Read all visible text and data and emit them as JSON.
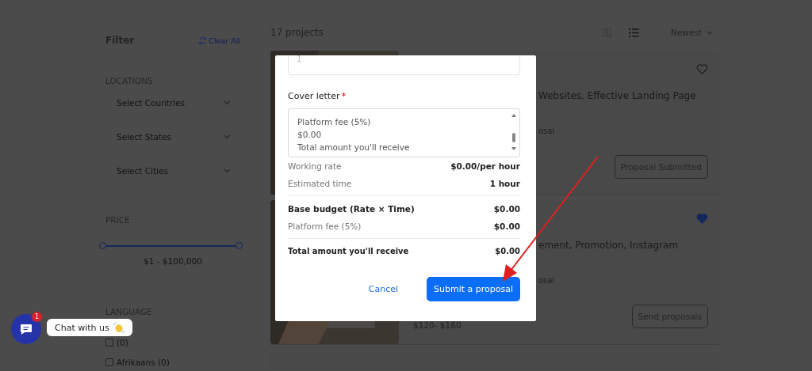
{
  "filter": {
    "title": "Filter",
    "clear_all": "Clear All",
    "locations_heading": "LOCATIONS",
    "selects": [
      "Select Countries",
      "Select States",
      "Select Cities"
    ],
    "price_heading": "PRICE",
    "price_range": {
      "low": {
        "level": 0
      },
      "high": {
        "level": 1
      }
    },
    "price_reading": "$1 - $100,000",
    "language_heading": "LANGUAGE",
    "languages": [
      {
        "label": "(0)",
        "checked": false
      },
      {
        "label": "Afrikaans (0)",
        "checked": false
      }
    ]
  },
  "toolbar": {
    "count": "17 projects",
    "views": [
      {
        "kind": "grid",
        "selected": false
      },
      {
        "kind": "list",
        "selected": true
      }
    ],
    "sort": "Newest"
  },
  "projects": [
    {
      "title": "Websites, Effective Landing Page",
      "meta": "osal",
      "favorite": false,
      "button": "Proposal Submitted"
    },
    {
      "title": "ement, Promotion, Instagram",
      "meta": "osal",
      "price": "$120- $160",
      "favorite": true,
      "button": "Send proposals"
    }
  ],
  "modal": {
    "field_value": "1",
    "cover_letter_label": "Cover letter",
    "required": true,
    "cover_letter_lines": [
      "Platform fee (5%)",
      "$0.00",
      "Total amount you'll receive"
    ],
    "sections": [
      {
        "rows": [
          {
            "label": "Working rate",
            "value": "$0.00/per hour",
            "kind": "plain"
          },
          {
            "label": "Estimated time",
            "value": "1 hour",
            "kind": "plain"
          }
        ]
      },
      {
        "rows": [
          {
            "label": "Base budget (Rate × Time)",
            "value": "$0.00",
            "kind": "strong"
          },
          {
            "label": "Platform fee (5%)",
            "value": "$0.00",
            "kind": "plain"
          }
        ]
      },
      {
        "rows": [
          {
            "label": "Total amount you'll receive",
            "value": "$0.00",
            "kind": "total"
          }
        ]
      }
    ],
    "cancel": "Cancel",
    "submit": "Submit a proposal"
  },
  "chat": {
    "badge": "1",
    "label": "Chat with us"
  }
}
